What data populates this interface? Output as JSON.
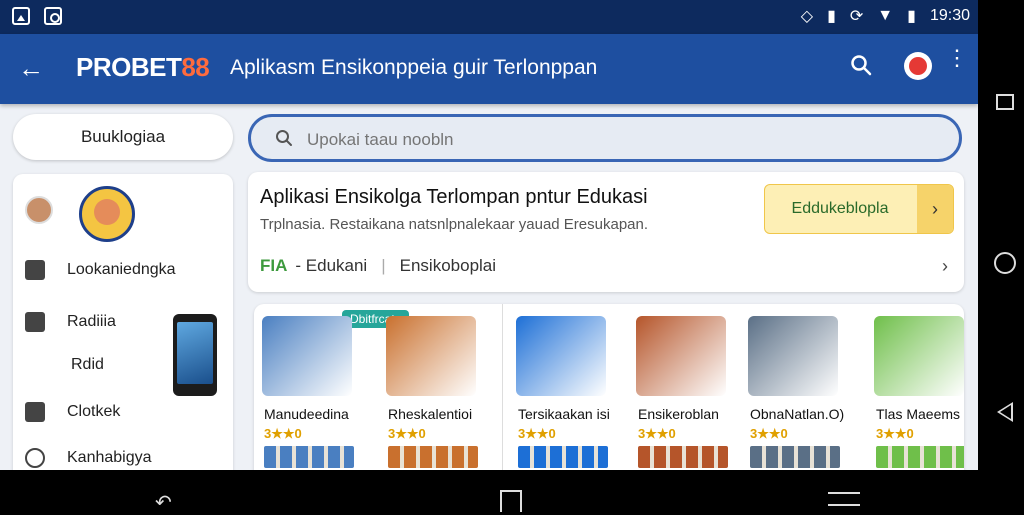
{
  "status_bar": {
    "time": "19:30",
    "icons": [
      "photo-icon",
      "camera-icon",
      "rotate-icon",
      "signal-icon",
      "sync-icon",
      "wifi-icon",
      "battery-icon"
    ]
  },
  "app_bar": {
    "brand_prefix": "PROBET",
    "brand_suffix": "88",
    "title": "Aplikasm Ensikonppeia guir Terlonppan",
    "back_glyph": "←",
    "more_glyph": "⋮",
    "icons": [
      "back-arrow-icon",
      "search-icon",
      "profile-icon",
      "more-vert-icon"
    ]
  },
  "chip": {
    "label": "Buuklogiaa"
  },
  "search": {
    "placeholder": "Upokai taau noobln"
  },
  "sidebar": {
    "items": [
      {
        "label": "Lookaniedngka",
        "icon": "home-lock-icon"
      },
      {
        "label": "Radiiia",
        "icon": "inbox-icon"
      },
      {
        "label": "Rdid",
        "icon": ""
      },
      {
        "label": "Clotkek",
        "icon": "save-icon"
      },
      {
        "label": "Kanhabigya",
        "icon": "clock-icon"
      }
    ]
  },
  "feature_card": {
    "title": "Aplikasi Ensikolga Terlompan pntur Edukasi",
    "description": "Trplnasia. Restaikana natsnlpnalekaar yauad Eresukapan.",
    "button_label": "Eddukeblopla",
    "button_arrow": "›",
    "meta_tag": "FIA",
    "meta_category": "- Edukani",
    "meta_sep": "|",
    "meta_secondary": "Ensikoboplai",
    "meta_chevron": "›"
  },
  "grid": {
    "badge": "Dbitfrcats",
    "tiles": [
      {
        "name": "Manudeedina",
        "rating": "3★★0",
        "color": "#4a7fc1"
      },
      {
        "name": "Rheskalentioi",
        "rating": "3★★0",
        "color": "#c9702e"
      },
      {
        "name": "Tersikaakan isi",
        "rating": "3★★0",
        "color": "#1d6fd6"
      },
      {
        "name": "Ensikeroblan",
        "rating": "3★★0",
        "color": "#b5552a"
      },
      {
        "name": "ObnaNatlan.O)",
        "rating": "3★★0",
        "color": "#5a6f86"
      },
      {
        "name": "Tlas Maeems",
        "rating": "3★★0",
        "color": "#6fbf4a"
      }
    ]
  }
}
